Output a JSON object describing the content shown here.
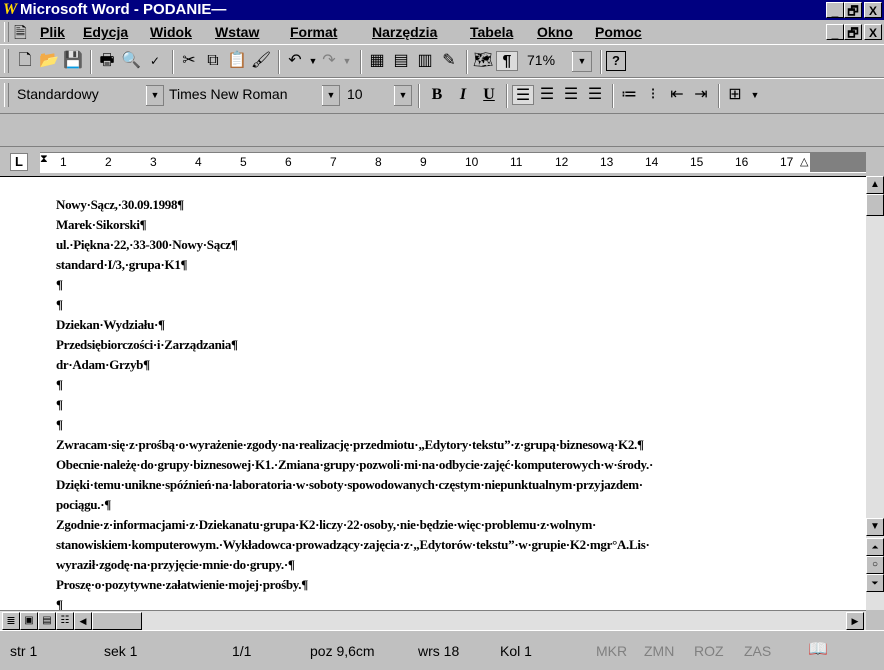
{
  "window": {
    "title": "Microsoft Word - PODANIE—",
    "logo": "W",
    "controls": [
      "_",
      "🗗",
      "X"
    ]
  },
  "menu": {
    "items": [
      "Plik",
      "Edycja",
      "Widok",
      "Wstaw",
      "Format",
      "Narzędzia",
      "Tabela",
      "Okno",
      "Pomoc"
    ]
  },
  "standard_toolbar": {
    "zoom": "71%"
  },
  "format_toolbar": {
    "style": "Standardowy",
    "font": "Times New Roman",
    "size": "10",
    "bold": "B",
    "italic": "I",
    "underline": "U"
  },
  "ruler": {
    "tab_marker": "L",
    "numbers": [
      "1",
      "2",
      "3",
      "4",
      "5",
      "6",
      "7",
      "8",
      "9",
      "10",
      "11",
      "12",
      "13",
      "14",
      "15",
      "16",
      "17"
    ]
  },
  "document": {
    "lines": [
      "Nowy·Sącz,·30.09.1998¶",
      "Marek·Sikorski¶",
      "ul.·Piękna·22,·33-300·Nowy·Sącz¶",
      "standard·I/3,·grupa·K1¶",
      "¶",
      "¶",
      "Dziekan·Wydziału·¶",
      "Przedsiębiorczości·i·Zarządzania¶",
      "dr·Adam·Grzyb¶",
      "¶",
      "¶",
      "¶",
      "Zwracam·się·z·prośbą·o·wyrażenie·zgody·na·realizację·przedmiotu·„Edytory·tekstu”·z·grupą·biznesową·K2.¶",
      "Obecnie·należę·do·grupy·biznesowej·K1.·Zmiana·grupy·pozwoli·mi·na·odbycie·zajęć·komputerowych·w·środy.·",
      "Dzięki·temu·unikne·spóźnień·na·laboratoria·w·soboty·spowodowanych·częstym·niepunktualnym·przyjazdem·",
      "pociągu.·¶",
      "Zgodnie·z·informacjami·z·Dziekanatu·grupa·K2·liczy·22·osoby,·nie·będzie·więc·problemu·z·wolnym·",
      "stanowiskiem·komputerowym.·Wykładowca·prowadzący·zajęcia·z·„Edytorów·tekstu”·w·grupie·K2·mgr°A.Lis·",
      "wyraził·zgodę·na·przyjęcie·mnie·do·grupy.·¶",
      "Proszę·o·pozytywne·załatwienie·mojej·prośby.¶",
      "¶"
    ]
  },
  "status": {
    "page": "str 1",
    "section": "sek 1",
    "pages": "1/1",
    "position": "poz 9,6cm",
    "line": "wrs 18",
    "column": "Kol 1",
    "modes": [
      "MKR",
      "ZMN",
      "ROZ",
      "ZAS"
    ]
  }
}
